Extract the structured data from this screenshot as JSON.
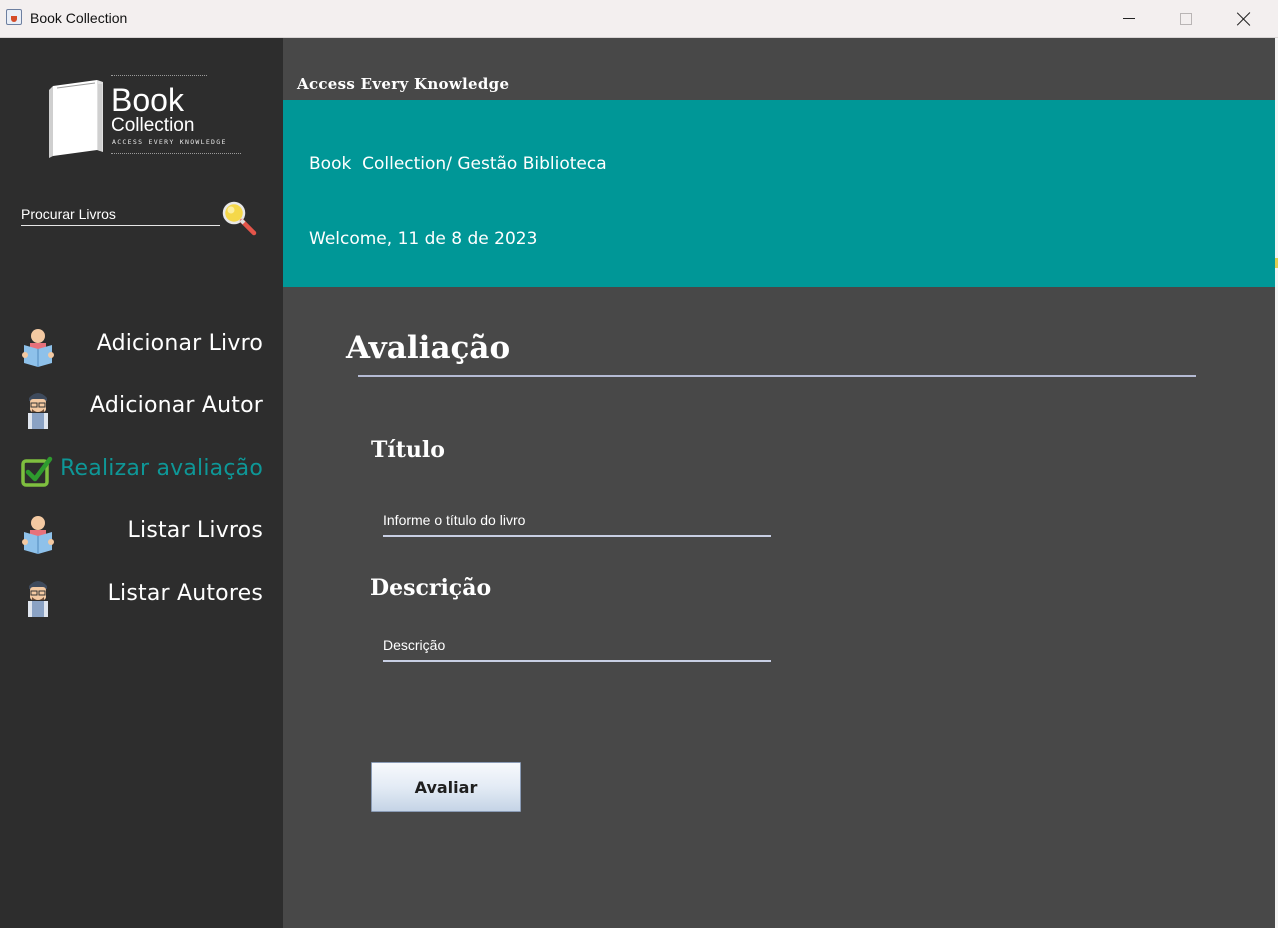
{
  "window": {
    "title": "Book Collection"
  },
  "sidebar": {
    "logo": {
      "title": "Book",
      "subtitle": "Collection",
      "tagline": "ACCESS EVERY KNOWLEDGE"
    },
    "search": {
      "placeholder": "Procurar Livros"
    },
    "items": [
      {
        "label": "Adicionar Livro",
        "icon": "reader-icon",
        "active": false
      },
      {
        "label": "Adicionar Autor",
        "icon": "author-icon",
        "active": false
      },
      {
        "label": "Realizar avaliação",
        "icon": "checkbox-icon",
        "active": true
      },
      {
        "label": "Listar Livros",
        "icon": "reader-icon",
        "active": false
      },
      {
        "label": "Listar Autores",
        "icon": "author-icon",
        "active": false
      }
    ],
    "active_color": "#0e9797"
  },
  "header": {
    "tagline": "Access Every Knowledge",
    "banner_title": "Book  Collection/ Gestão Biblioteca",
    "welcome": "Welcome, 11 de 8 de 2023",
    "banner_color": "#009797"
  },
  "form": {
    "title": "Avaliação",
    "titulo_label": "Título",
    "titulo_placeholder": "Informe o título do livro",
    "descricao_label": "Descrição",
    "descricao_placeholder": "Descrição",
    "submit_label": "Avaliar"
  }
}
